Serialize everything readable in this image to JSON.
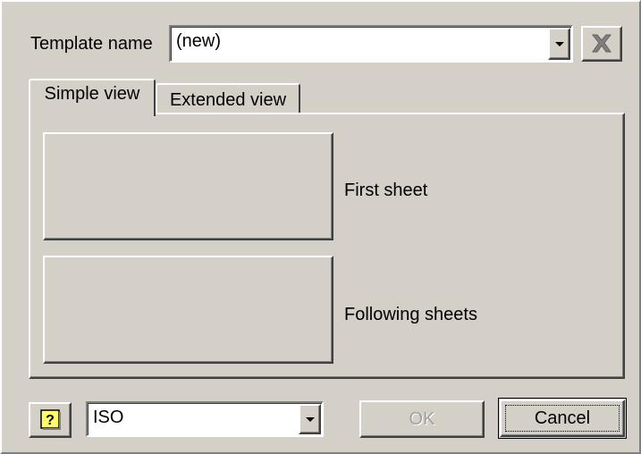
{
  "template_name": {
    "label": "Template name",
    "value": "(new)"
  },
  "delete_button": {
    "icon": "x-delete-icon"
  },
  "tabs": [
    {
      "label": "Simple view",
      "active": true
    },
    {
      "label": "Extended view",
      "active": false
    }
  ],
  "sheets": {
    "first_label": "First sheet",
    "following_label": "Following sheets"
  },
  "footer": {
    "help_icon": "help-question-icon",
    "standard_value": "ISO",
    "ok_label": "OK",
    "cancel_label": "Cancel"
  },
  "colors": {
    "face": "#d4d0c8",
    "highlight": "#ffffff",
    "shadow": "#808080",
    "dark_shadow": "#404040",
    "help_yellow": "#ffff00"
  }
}
